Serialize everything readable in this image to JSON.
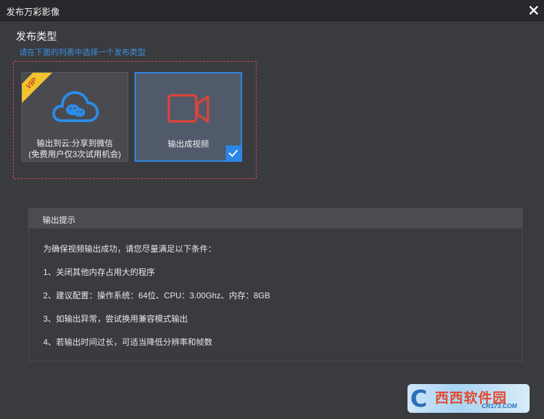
{
  "window": {
    "title": "发布万彩影像"
  },
  "publish_type": {
    "title": "发布类型",
    "hint": "请在下面的列表中选择一个发布类型",
    "options": [
      {
        "label_line1": "输出到云:分享到微信",
        "label_line2": "(免费用户仅3次试用机会)",
        "badge": "VIP",
        "icon": "cloud-wechat-icon",
        "selected": false
      },
      {
        "label_line1": "输出成视频",
        "icon": "video-camera-icon",
        "selected": true
      }
    ]
  },
  "tips": {
    "header": "输出提示",
    "intro": "为确保视频输出成功，请您尽量满足以下条件：",
    "items": [
      "1、关闭其他内存占用大的程序",
      "2、建议配置：操作系统：64位、CPU：3.00Ghz、内存：8GB",
      "3、如输出异常，尝试换用兼容模式输出",
      "4、若输出时间过长，可适当降低分辨率和帧数"
    ]
  },
  "watermark": {
    "text": "西西软件园",
    "sub": "CR173.COM"
  },
  "colors": {
    "accent": "#2c86e6",
    "dashed_border": "#e0464b",
    "hint": "#3d8fe0",
    "vip": "#f2c230",
    "video_icon": "#d9443a"
  }
}
